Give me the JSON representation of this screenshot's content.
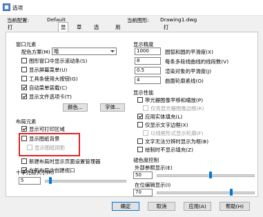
{
  "window": {
    "title": "选项",
    "icon": "options-app-icon"
  },
  "profile": {
    "current_config_label": "当前配置:",
    "current_config_value": "Default",
    "current_drawing_label": "当前图形:",
    "current_drawing_value": "Drawing1.dwg"
  },
  "tabs": [
    {
      "label": "打开和保存 文件",
      "active": false
    },
    {
      "label": "显示",
      "active": true
    },
    {
      "label": "草图",
      "active": false
    },
    {
      "label": "选择集",
      "active": false
    },
    {
      "label": "用户系统配置 配置",
      "active": false
    },
    {
      "label": "打印",
      "active": false
    }
  ],
  "window_elements": {
    "title": "窗口元素",
    "color_scheme_label": "配色方案(M)",
    "color_scheme_value": "暗",
    "options": [
      {
        "label": "图形窗口中显示滚动条(S)",
        "checked": false
      },
      {
        "label": "显示屏幕菜单(U)",
        "checked": false
      },
      {
        "label": "工具条使用大按钮(G)",
        "checked": false
      },
      {
        "label": "自动菜单装载(C)",
        "checked": true
      },
      {
        "label": "显示文件选项卡(T)",
        "checked": true
      }
    ],
    "colors_button": "颜色...",
    "fonts_button": "字体..."
  },
  "layout_elements": {
    "title": "布局元素",
    "show_printable_area": {
      "label": "显示可打印区域",
      "checked": true
    },
    "show_paper_background": {
      "label": "显示图纸背景",
      "checked": false
    },
    "show_paper_shadow": {
      "label": "显示图纸阴影",
      "checked": false
    },
    "new_layout_page_setup": {
      "label": "新建布局时显示页面设置管理器",
      "checked": false
    },
    "create_viewport": {
      "label": "在新布局中创建视口",
      "checked": true
    }
  },
  "crosshair": {
    "title": "十字光标大小(R)",
    "value": "5",
    "level": 5
  },
  "display_resolution": {
    "title": "显示精度",
    "items": [
      {
        "value": "1000",
        "label": "圆弧和圆的平滑度(X)"
      },
      {
        "value": "8",
        "label": "每条多段线曲线的线段数(V)"
      },
      {
        "value": "0.5",
        "label": "渲染对象的平滑度(J)"
      },
      {
        "value": "4",
        "label": "曲面轮廓素线(O)"
      }
    ]
  },
  "display_performance": {
    "title": "显示性能",
    "items": [
      {
        "label": "带光栅图像平移和缩放(P)",
        "checked": false,
        "disabled": false
      },
      {
        "label": "仅亮显光栅图像边框(R)",
        "checked": false,
        "disabled": true
      },
      {
        "label": "应用实体填充(L)",
        "checked": true,
        "disabled": false
      },
      {
        "label": "仅显示文字边框(X)",
        "checked": false,
        "disabled": false
      },
      {
        "label": "以线框形式显示轮廓(F)",
        "checked": false,
        "disabled": true
      },
      {
        "label": "文字无法分辨时显示为框(B)",
        "checked": false,
        "disabled": false
      },
      {
        "label": "绘制时不显示填充(Z)",
        "checked": false,
        "disabled": false
      }
    ]
  },
  "fade_control": {
    "title": "褪色度控制",
    "xref_label": "外部参照显示(E)",
    "xref_value": "50",
    "xref_level": 50,
    "inplace_label": "在位编辑显示(I)",
    "inplace_value": "70",
    "inplace_level": 70
  },
  "footer": {
    "ok": "确定",
    "cancel": "取消",
    "apply": "应用(A)",
    "help": "帮助(H)"
  },
  "colors": {
    "accent": "#0078d7",
    "highlight": "#e12020"
  }
}
